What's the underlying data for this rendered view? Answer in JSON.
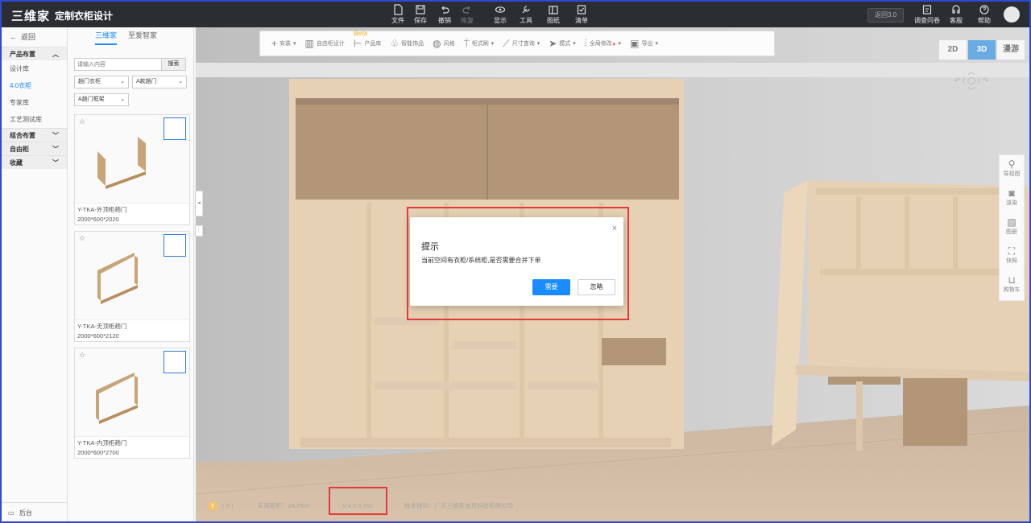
{
  "topbar": {
    "brand": "三维家",
    "app_name": "定制衣柜设计",
    "tools": [
      {
        "label": "文件",
        "icon": "file-icon"
      },
      {
        "label": "保存",
        "icon": "save-icon"
      },
      {
        "label": "撤销",
        "icon": "undo-icon"
      },
      {
        "label": "恢复",
        "icon": "redo-icon"
      },
      {
        "label": "显示",
        "icon": "eye-icon"
      },
      {
        "label": "工具",
        "icon": "wrench-icon"
      },
      {
        "label": "图纸",
        "icon": "blueprint-icon"
      },
      {
        "label": "清单",
        "icon": "checklist-icon"
      }
    ],
    "version_button": "返回3.0",
    "right_tools": [
      {
        "label": "调查问卷",
        "icon": "survey-icon"
      },
      {
        "label": "客服",
        "icon": "headset-icon"
      },
      {
        "label": "帮助",
        "icon": "help-icon"
      }
    ]
  },
  "leftnav": {
    "back": "返回",
    "categories": [
      {
        "label": "产品布置",
        "items": [
          "设计库",
          "4.0衣柜",
          "专家库",
          "工艺测试库"
        ]
      },
      {
        "label": "组合布置",
        "items": []
      },
      {
        "label": "自由柜",
        "items": []
      },
      {
        "label": "收藏",
        "items": []
      }
    ],
    "active_item": "4.0衣柜",
    "backend": "后台"
  },
  "panel": {
    "tabs": [
      "三维家",
      "至爱智家"
    ],
    "search_placeholder": "请输入内容",
    "search_button": "搜索",
    "filters": [
      "趟门衣柜",
      "A款趟门",
      "A趟门框架"
    ],
    "products": [
      {
        "name": "Y-TKA-外顶柜趟门",
        "dims": "2000*600*2020"
      },
      {
        "name": "Y-TKA-无顶柜趟门",
        "dims": "2000*600*2120"
      },
      {
        "name": "Y-TKA-内顶柜趟门",
        "dims": "2000*600*2700"
      }
    ]
  },
  "toolbar2": {
    "items": [
      "安装",
      "自由柜设计",
      "产品库",
      "智能饰品",
      "风格",
      "柜式刷",
      "尺寸查询",
      "模式",
      "全局修改",
      "导出"
    ],
    "beta": "Beta"
  },
  "views": [
    "2D",
    "3D",
    "漫游"
  ],
  "right_tools": [
    "导视图",
    "渲染",
    "图册",
    "快照",
    "购物车"
  ],
  "status": {
    "warning_count": "( 0 )",
    "area": "实用面积：24.75m²",
    "version": "V:4.0.0.762",
    "provider": "技术提供：广东三维家信息科技有限公司"
  },
  "dialog": {
    "title": "提示",
    "message": "当前空间有衣柜/系统柜,是否需要合并下单",
    "confirm": "需要",
    "ignore": "忽略"
  },
  "colors": {
    "accent": "#1a8cff",
    "topbar": "#2a2e33",
    "highlight": "#e23b3b"
  }
}
